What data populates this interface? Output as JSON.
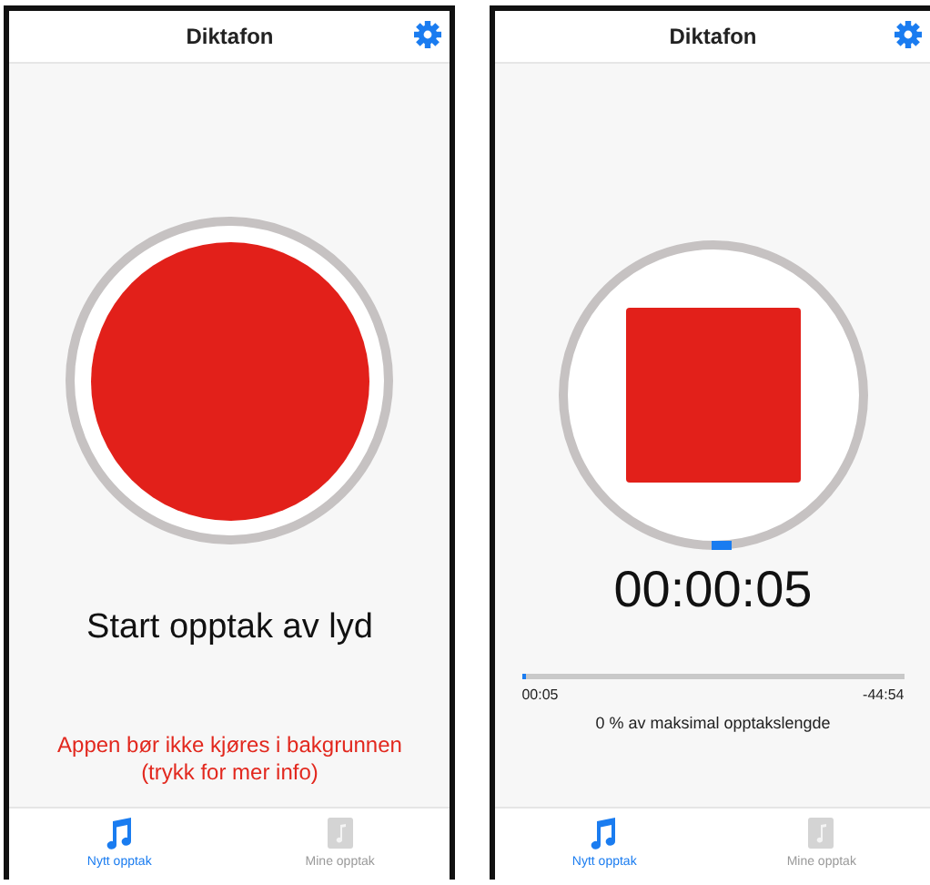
{
  "screens": [
    {
      "kind": "idle",
      "title": "Diktafon",
      "start_label": "Start opptak av lyd",
      "warning": "Appen bør ikke kjøres i bakgrunnen (trykk for mer info)",
      "tabs": [
        {
          "label": "Nytt opptak",
          "selected": true,
          "kind": "new"
        },
        {
          "label": "Mine opptak",
          "selected": false,
          "kind": "list"
        }
      ]
    },
    {
      "kind": "recording",
      "title": "Diktafon",
      "timer": "00:00:05",
      "progress": {
        "level": 0.01,
        "elapsed": "00:05",
        "remaining": "-44:54"
      },
      "percent_label": "0 % av maksimal opptakslengde",
      "tabs": [
        {
          "label": "Nytt opptak",
          "selected": true,
          "kind": "new"
        },
        {
          "label": "Mine opptak",
          "selected": false,
          "kind": "list"
        }
      ]
    }
  ]
}
